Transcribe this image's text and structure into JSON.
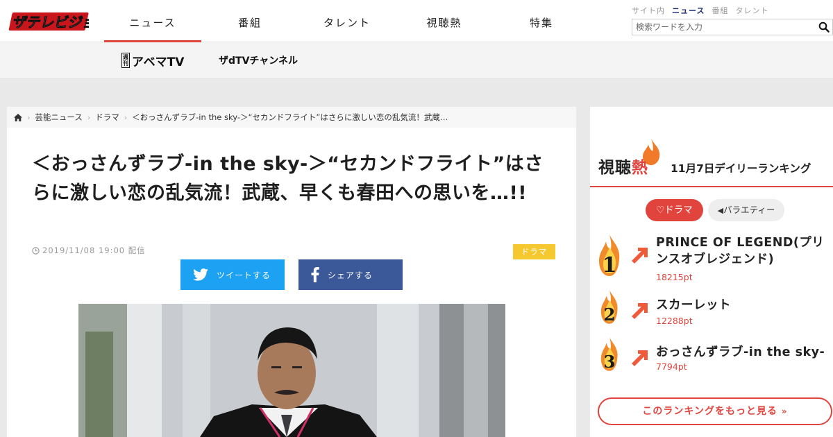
{
  "header": {
    "logo_text": "ザテレビジョン",
    "nav": [
      "ニュース",
      "番組",
      "タレント",
      "視聴熱",
      "特集"
    ],
    "search_tabs": [
      "サイト内",
      "ニュース",
      "番組",
      "タレント"
    ],
    "search_placeholder": "検索ワードを入力"
  },
  "subnav": {
    "abema_mini": "週刊",
    "abema": "アベマTV",
    "dtv": "ザdTVチャンネル"
  },
  "breadcrumb": [
    "芸能ニュース",
    "ドラマ",
    "＜おっさんずラブ-in the sky-＞“セカンドフライト”はさらに激しい恋の乱気流！武蔵…"
  ],
  "article": {
    "title": "＜おっさんずラブ-in the sky-＞“セカンドフライト”はさらに激しい恋の乱気流！武蔵、早くも春田への思いを…!!",
    "datetime": "2019/11/08 19:00 配信",
    "category": "ドラマ",
    "tweet_label": "ツイートする",
    "share_label": "シェアする"
  },
  "ranking": {
    "logo_prefix": "視聴",
    "logo_fire": "熱",
    "date_title": "11月7日デイリーランキング",
    "tab_drama": "ドラマ",
    "tab_variety": "バラエティー",
    "items": [
      {
        "rank": "1",
        "title": "PRINCE OF LEGEND(プリンスオブレジェンド)",
        "points": "18215pt"
      },
      {
        "rank": "2",
        "title": "スカーレット",
        "points": "12288pt"
      },
      {
        "rank": "3",
        "title": "おっさんずラブ-in the sky-",
        "points": "7794pt"
      }
    ],
    "more_label": "このランキングをもっと見る"
  },
  "colors": {
    "accent": "#e0443c",
    "twitter": "#1da1f2",
    "facebook": "#3b5998",
    "tag": "#f6c830"
  }
}
